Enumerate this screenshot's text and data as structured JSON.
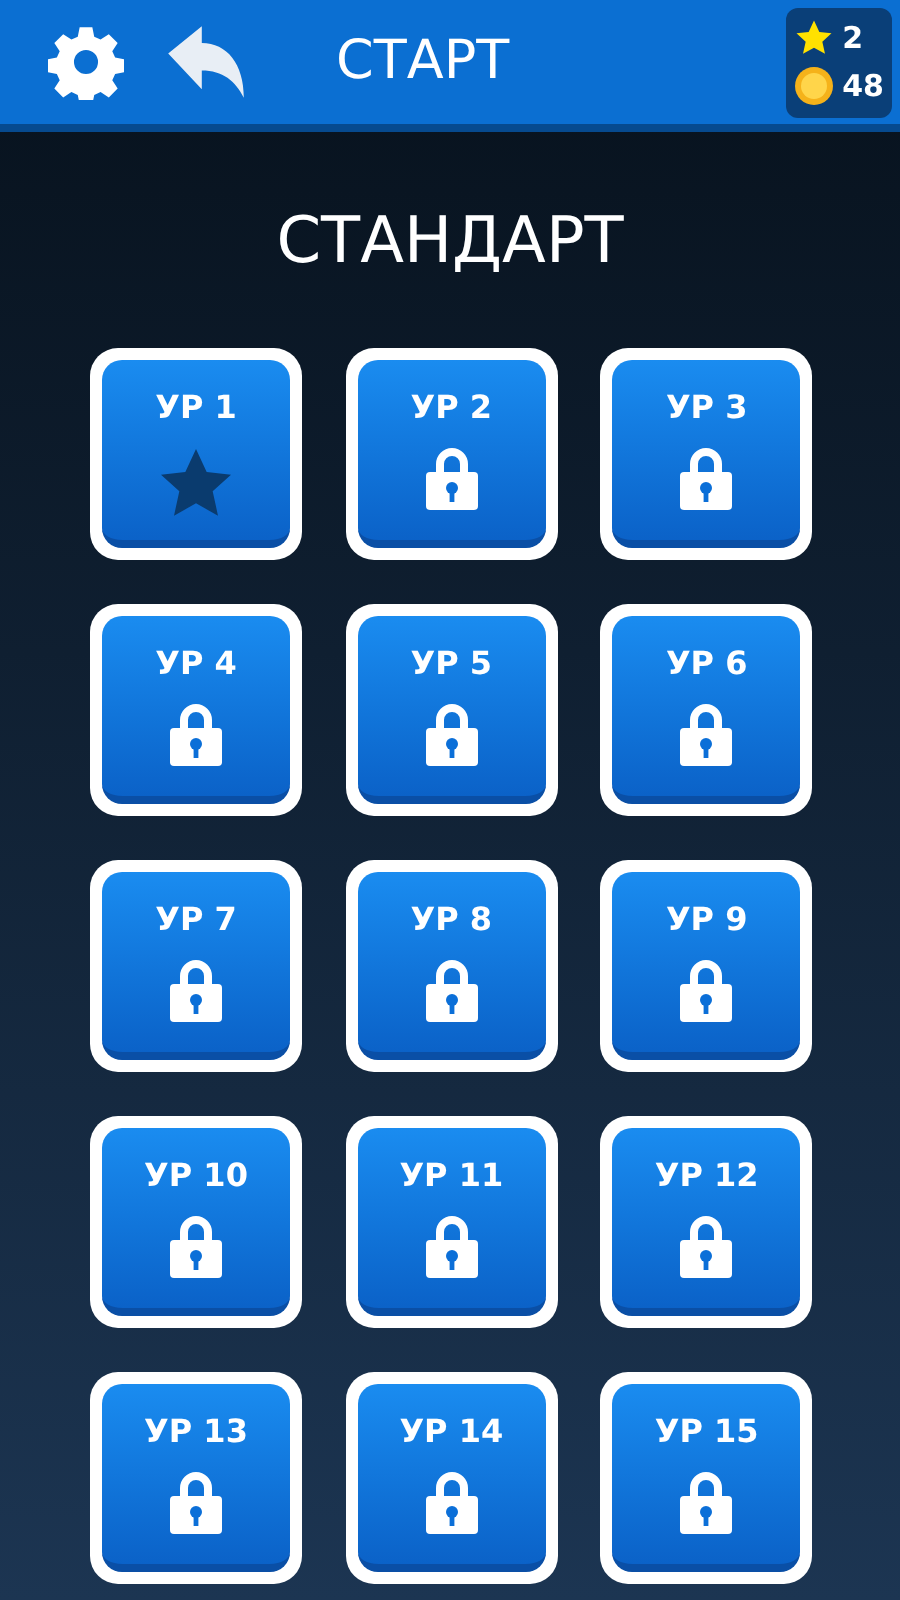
{
  "header": {
    "title": "СТАРТ",
    "stars": "2",
    "coins": "48"
  },
  "section_title": "СТАНДАРТ",
  "levels": [
    {
      "label": "УР 1",
      "locked": false
    },
    {
      "label": "УР 2",
      "locked": true
    },
    {
      "label": "УР 3",
      "locked": true
    },
    {
      "label": "УР 4",
      "locked": true
    },
    {
      "label": "УР 5",
      "locked": true
    },
    {
      "label": "УР 6",
      "locked": true
    },
    {
      "label": "УР 7",
      "locked": true
    },
    {
      "label": "УР 8",
      "locked": true
    },
    {
      "label": "УР 9",
      "locked": true
    },
    {
      "label": "УР 10",
      "locked": true
    },
    {
      "label": "УР 11",
      "locked": true
    },
    {
      "label": "УР 12",
      "locked": true
    },
    {
      "label": "УР 13",
      "locked": true
    },
    {
      "label": "УР 14",
      "locked": true
    },
    {
      "label": "УР 15",
      "locked": true
    }
  ]
}
